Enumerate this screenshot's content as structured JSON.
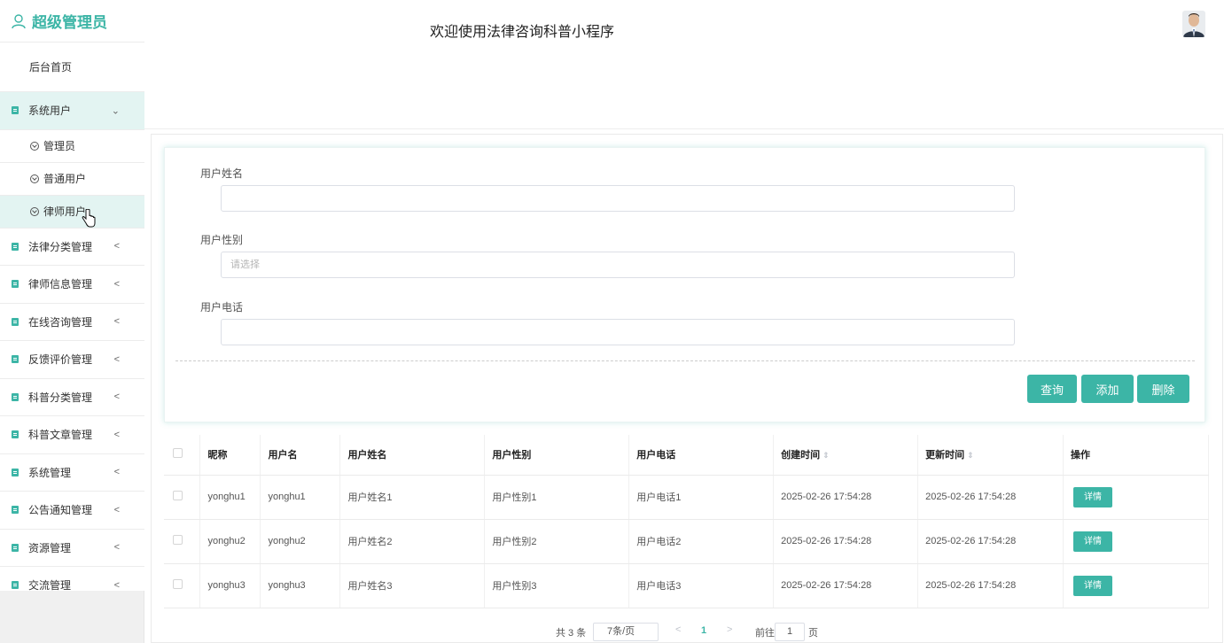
{
  "sidebar": {
    "brand": "超级管理员",
    "home": "后台首页",
    "system_users": "系统用户",
    "sub_items": [
      "管理员",
      "普通用户",
      "律师用户"
    ],
    "menus": [
      "法律分类管理",
      "律师信息管理",
      "在线咨询管理",
      "反馈评价管理",
      "科普分类管理",
      "科普文章管理",
      "系统管理",
      "公告通知管理",
      "资源管理",
      "交流管理"
    ]
  },
  "header": {
    "title": "欢迎使用法律咨询科普小程序"
  },
  "search": {
    "name_label": "用户姓名",
    "name_value": "",
    "gender_label": "用户性别",
    "gender_placeholder": "请选择",
    "phone_label": "用户电话",
    "phone_value": "",
    "query_btn": "查询",
    "add_btn": "添加",
    "delete_btn": "删除"
  },
  "table": {
    "columns": [
      "昵称",
      "用户名",
      "用户姓名",
      "用户性别",
      "用户电话",
      "创建时间",
      "更新时间",
      "操作"
    ],
    "rows": [
      [
        "yonghu1",
        "yonghu1",
        "用户姓名1",
        "用户性别1",
        "用户电话1",
        "2025-02-26 17:54:28",
        "2025-02-26 17:54:28",
        "详情"
      ],
      [
        "yonghu2",
        "yonghu2",
        "用户姓名2",
        "用户性别2",
        "用户电话2",
        "2025-02-26 17:54:28",
        "2025-02-26 17:54:28",
        "详情"
      ],
      [
        "yonghu3",
        "yonghu3",
        "用户姓名3",
        "用户性别3",
        "用户电话3",
        "2025-02-26 17:54:28",
        "2025-02-26 17:54:28",
        "详情"
      ]
    ]
  },
  "pager": {
    "total": "共 3 条",
    "page_size": "7条/页",
    "prev": "<",
    "current": "1",
    "next": ">",
    "goto": "前往",
    "goto_value": "1",
    "unit": "页"
  },
  "colors": {
    "accent": "#3cb5a6"
  }
}
